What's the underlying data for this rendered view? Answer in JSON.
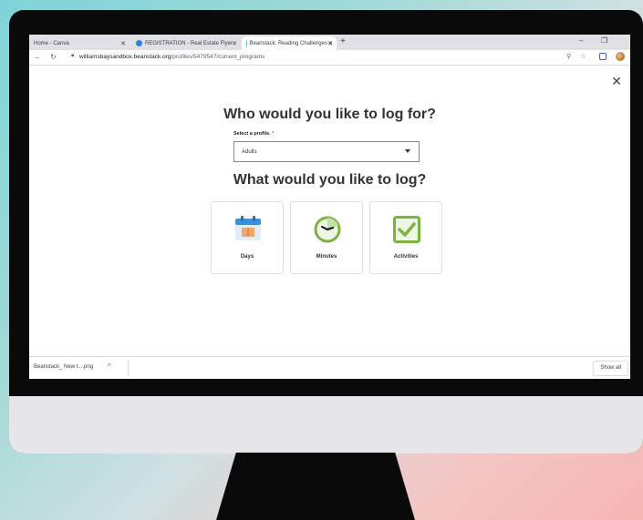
{
  "browser": {
    "tabs": [
      {
        "label": "Home - Canva",
        "active": false
      },
      {
        "label": "REGISTRATION - Real Estate Flyer",
        "active": false
      },
      {
        "label": "Beanstack: Reading Challenges a",
        "active": true
      }
    ],
    "new_tab_label": "+",
    "url_host": "williamsbaysandbox.beanstack.org",
    "url_path": "/profiles/5479547/current_programs"
  },
  "page": {
    "heading_profile": "Who would you like to log for?",
    "select_label": "Select a profile.",
    "required_mark": "*",
    "select_value": "Adults",
    "heading_log": "What would you like to log?",
    "options": [
      {
        "label": "Days",
        "icon": "calendar-icon"
      },
      {
        "label": "Minutes",
        "icon": "clock-icon"
      },
      {
        "label": "Activities",
        "icon": "checkbox-icon"
      }
    ],
    "colors": {
      "accent_blue": "#3d8fd6",
      "accent_green": "#7cb342"
    }
  },
  "downloads": {
    "item": "Beanstack_ New t....png",
    "show_all": "Show all"
  }
}
